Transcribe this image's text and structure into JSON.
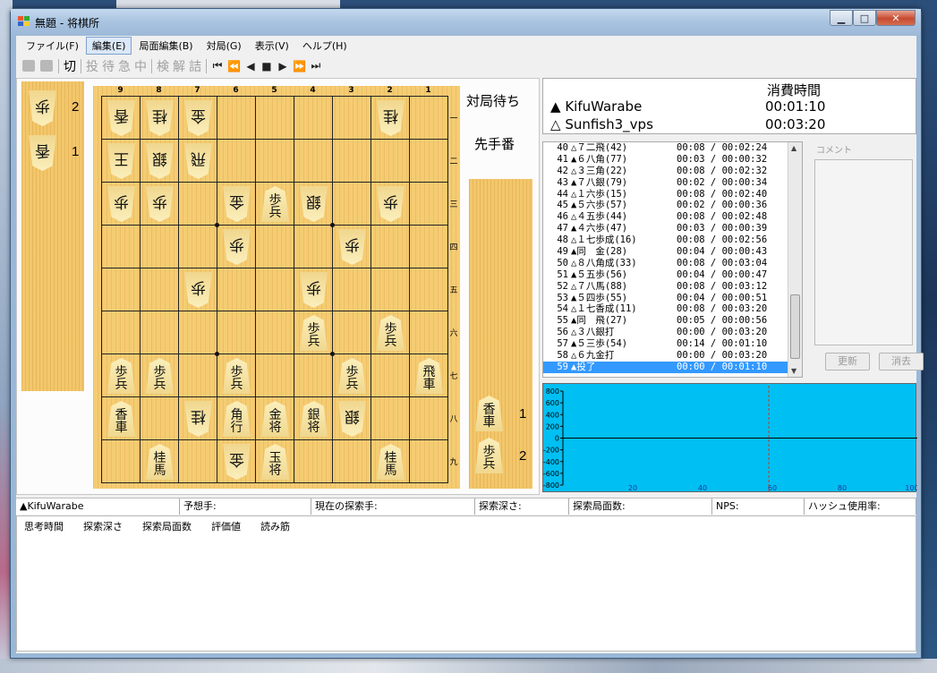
{
  "window": {
    "title": "無題 - 将棋所"
  },
  "menu": [
    "ファイル(F)",
    "編集(E)",
    "局面編集(B)",
    "対局(G)",
    "表示(V)",
    "ヘルプ(H)"
  ],
  "toolbar": [
    "切",
    "投",
    "待",
    "急",
    "中",
    "検",
    "解",
    "詰",
    "⏮",
    "⏪",
    "◀",
    "■",
    "▶",
    "⏩",
    "⏭"
  ],
  "board": {
    "files": [
      "9",
      "8",
      "7",
      "6",
      "5",
      "4",
      "3",
      "2",
      "1"
    ],
    "ranks": [
      "一",
      "二",
      "三",
      "四",
      "五",
      "六",
      "七",
      "八",
      "九"
    ],
    "pieces": [
      {
        "f": 9,
        "r": 1,
        "t": [
          "香"
        ],
        "g": true
      },
      {
        "f": 8,
        "r": 1,
        "t": [
          "桂"
        ],
        "g": true
      },
      {
        "f": 7,
        "r": 1,
        "t": [
          "金"
        ],
        "g": true
      },
      {
        "f": 2,
        "r": 1,
        "t": [
          "桂"
        ],
        "g": true
      },
      {
        "f": 9,
        "r": 2,
        "t": [
          "王"
        ],
        "g": true
      },
      {
        "f": 8,
        "r": 2,
        "t": [
          "銀"
        ],
        "g": true
      },
      {
        "f": 7,
        "r": 2,
        "t": [
          "飛"
        ],
        "g": true
      },
      {
        "f": 9,
        "r": 3,
        "t": [
          "歩"
        ],
        "g": true
      },
      {
        "f": 8,
        "r": 3,
        "t": [
          "歩"
        ],
        "g": true
      },
      {
        "f": 6,
        "r": 3,
        "t": [
          "金"
        ],
        "g": true
      },
      {
        "f": 5,
        "r": 3,
        "t": [
          "歩",
          "兵"
        ],
        "g": false
      },
      {
        "f": 4,
        "r": 3,
        "t": [
          "銀"
        ],
        "g": true
      },
      {
        "f": 2,
        "r": 3,
        "t": [
          "歩"
        ],
        "g": true
      },
      {
        "f": 6,
        "r": 4,
        "t": [
          "歩"
        ],
        "g": true
      },
      {
        "f": 3,
        "r": 4,
        "t": [
          "歩"
        ],
        "g": true
      },
      {
        "f": 7,
        "r": 5,
        "t": [
          "歩"
        ],
        "g": true
      },
      {
        "f": 4,
        "r": 5,
        "t": [
          "歩"
        ],
        "g": true
      },
      {
        "f": 4,
        "r": 6,
        "t": [
          "歩",
          "兵"
        ],
        "g": false
      },
      {
        "f": 2,
        "r": 6,
        "t": [
          "歩",
          "兵"
        ],
        "g": false
      },
      {
        "f": 9,
        "r": 7,
        "t": [
          "歩",
          "兵"
        ],
        "g": false
      },
      {
        "f": 8,
        "r": 7,
        "t": [
          "歩",
          "兵"
        ],
        "g": false
      },
      {
        "f": 6,
        "r": 7,
        "t": [
          "歩",
          "兵"
        ],
        "g": false
      },
      {
        "f": 3,
        "r": 7,
        "t": [
          "歩",
          "兵"
        ],
        "g": false
      },
      {
        "f": 1,
        "r": 7,
        "t": [
          "飛",
          "車"
        ],
        "g": false
      },
      {
        "f": 9,
        "r": 8,
        "t": [
          "香",
          "車"
        ],
        "g": false
      },
      {
        "f": 7,
        "r": 8,
        "t": [
          "桂"
        ],
        "g": true
      },
      {
        "f": 6,
        "r": 8,
        "t": [
          "角",
          "行"
        ],
        "g": false
      },
      {
        "f": 5,
        "r": 8,
        "t": [
          "金",
          "将"
        ],
        "g": false
      },
      {
        "f": 4,
        "r": 8,
        "t": [
          "銀",
          "将"
        ],
        "g": false
      },
      {
        "f": 3,
        "r": 8,
        "t": [
          "銀"
        ],
        "g": true
      },
      {
        "f": 8,
        "r": 9,
        "t": [
          "桂",
          "馬"
        ],
        "g": false
      },
      {
        "f": 6,
        "r": 9,
        "t": [
          "金"
        ],
        "g": true
      },
      {
        "f": 5,
        "r": 9,
        "t": [
          "玉",
          "将"
        ],
        "g": false
      },
      {
        "f": 2,
        "r": 9,
        "t": [
          "桂",
          "馬"
        ],
        "g": false
      }
    ]
  },
  "gote_hand": [
    {
      "t": [
        "歩"
      ],
      "count": "2"
    },
    {
      "t": [
        "香"
      ],
      "count": "1"
    }
  ],
  "sente_hand": [
    {
      "t": [
        "香",
        "車"
      ],
      "count": "1"
    },
    {
      "t": [
        "歩",
        "兵"
      ],
      "count": "2"
    }
  ],
  "status": {
    "waiting": "対局待ち",
    "turn": "先手番"
  },
  "time": {
    "header": "消費時間",
    "players": [
      {
        "mark": "▲",
        "name": "KifuWarabe",
        "time": "00:01:10"
      },
      {
        "mark": "△",
        "name": "Sunfish3_vps",
        "time": "00:03:20"
      }
    ]
  },
  "kifu": [
    {
      "no": "40",
      "mv": "△７二飛(42)",
      "tm": "00:08 / 00:02:24"
    },
    {
      "no": "41",
      "mv": "▲６八角(77)",
      "tm": "00:03 / 00:00:32"
    },
    {
      "no": "42",
      "mv": "△３三角(22)",
      "tm": "00:08 / 00:02:32"
    },
    {
      "no": "43",
      "mv": "▲７八銀(79)",
      "tm": "00:02 / 00:00:34"
    },
    {
      "no": "44",
      "mv": "△１六歩(15)",
      "tm": "00:08 / 00:02:40"
    },
    {
      "no": "45",
      "mv": "▲５六歩(57)",
      "tm": "00:02 / 00:00:36"
    },
    {
      "no": "46",
      "mv": "△４五歩(44)",
      "tm": "00:08 / 00:02:48"
    },
    {
      "no": "47",
      "mv": "▲４六歩(47)",
      "tm": "00:03 / 00:00:39"
    },
    {
      "no": "48",
      "mv": "△１七歩成(16)",
      "tm": "00:08 / 00:02:56"
    },
    {
      "no": "49",
      "mv": "▲同　金(28)",
      "tm": "00:04 / 00:00:43"
    },
    {
      "no": "50",
      "mv": "△８八角成(33)",
      "tm": "00:08 / 00:03:04"
    },
    {
      "no": "51",
      "mv": "▲５五歩(56)",
      "tm": "00:04 / 00:00:47"
    },
    {
      "no": "52",
      "mv": "△７八馬(88)",
      "tm": "00:08 / 00:03:12"
    },
    {
      "no": "53",
      "mv": "▲５四歩(55)",
      "tm": "00:04 / 00:00:51"
    },
    {
      "no": "54",
      "mv": "△１七香成(11)",
      "tm": "00:08 / 00:03:20"
    },
    {
      "no": "55",
      "mv": "▲同　飛(27)",
      "tm": "00:05 / 00:00:56"
    },
    {
      "no": "56",
      "mv": "△３八銀打",
      "tm": "00:00 / 00:03:20"
    },
    {
      "no": "57",
      "mv": "▲５三歩(54)",
      "tm": "00:14 / 00:01:10"
    },
    {
      "no": "58",
      "mv": "△６九金打",
      "tm": "00:00 / 00:03:20"
    },
    {
      "no": "59",
      "mv": "▲投了",
      "tm": "00:00 / 00:01:10"
    }
  ],
  "kifu_selected": "59",
  "comment": {
    "title": "コメント",
    "update": "更新",
    "clear": "消去"
  },
  "graph": {
    "y_ticks": [
      "800",
      "600",
      "400",
      "200",
      "0",
      "-200",
      "-400",
      "-600",
      "-800"
    ],
    "x_ticks": [
      "20",
      "40",
      "60",
      "80",
      "100"
    ],
    "colors": {
      "bg": "#00bff2",
      "axis": "#000000",
      "marker": "#c0392b"
    }
  },
  "infobar": [
    {
      "label": "▲KifuWarabe"
    },
    {
      "label": "予想手:"
    },
    {
      "label": "現在の探索手:"
    },
    {
      "label": "探索深さ:"
    },
    {
      "label": "探索局面数:"
    },
    {
      "label": "NPS:"
    },
    {
      "label": "ハッシュ使用率:"
    }
  ],
  "pv_headers": [
    "思考時間",
    "探索深さ",
    "探索局面数",
    "評価値",
    "読み筋"
  ]
}
